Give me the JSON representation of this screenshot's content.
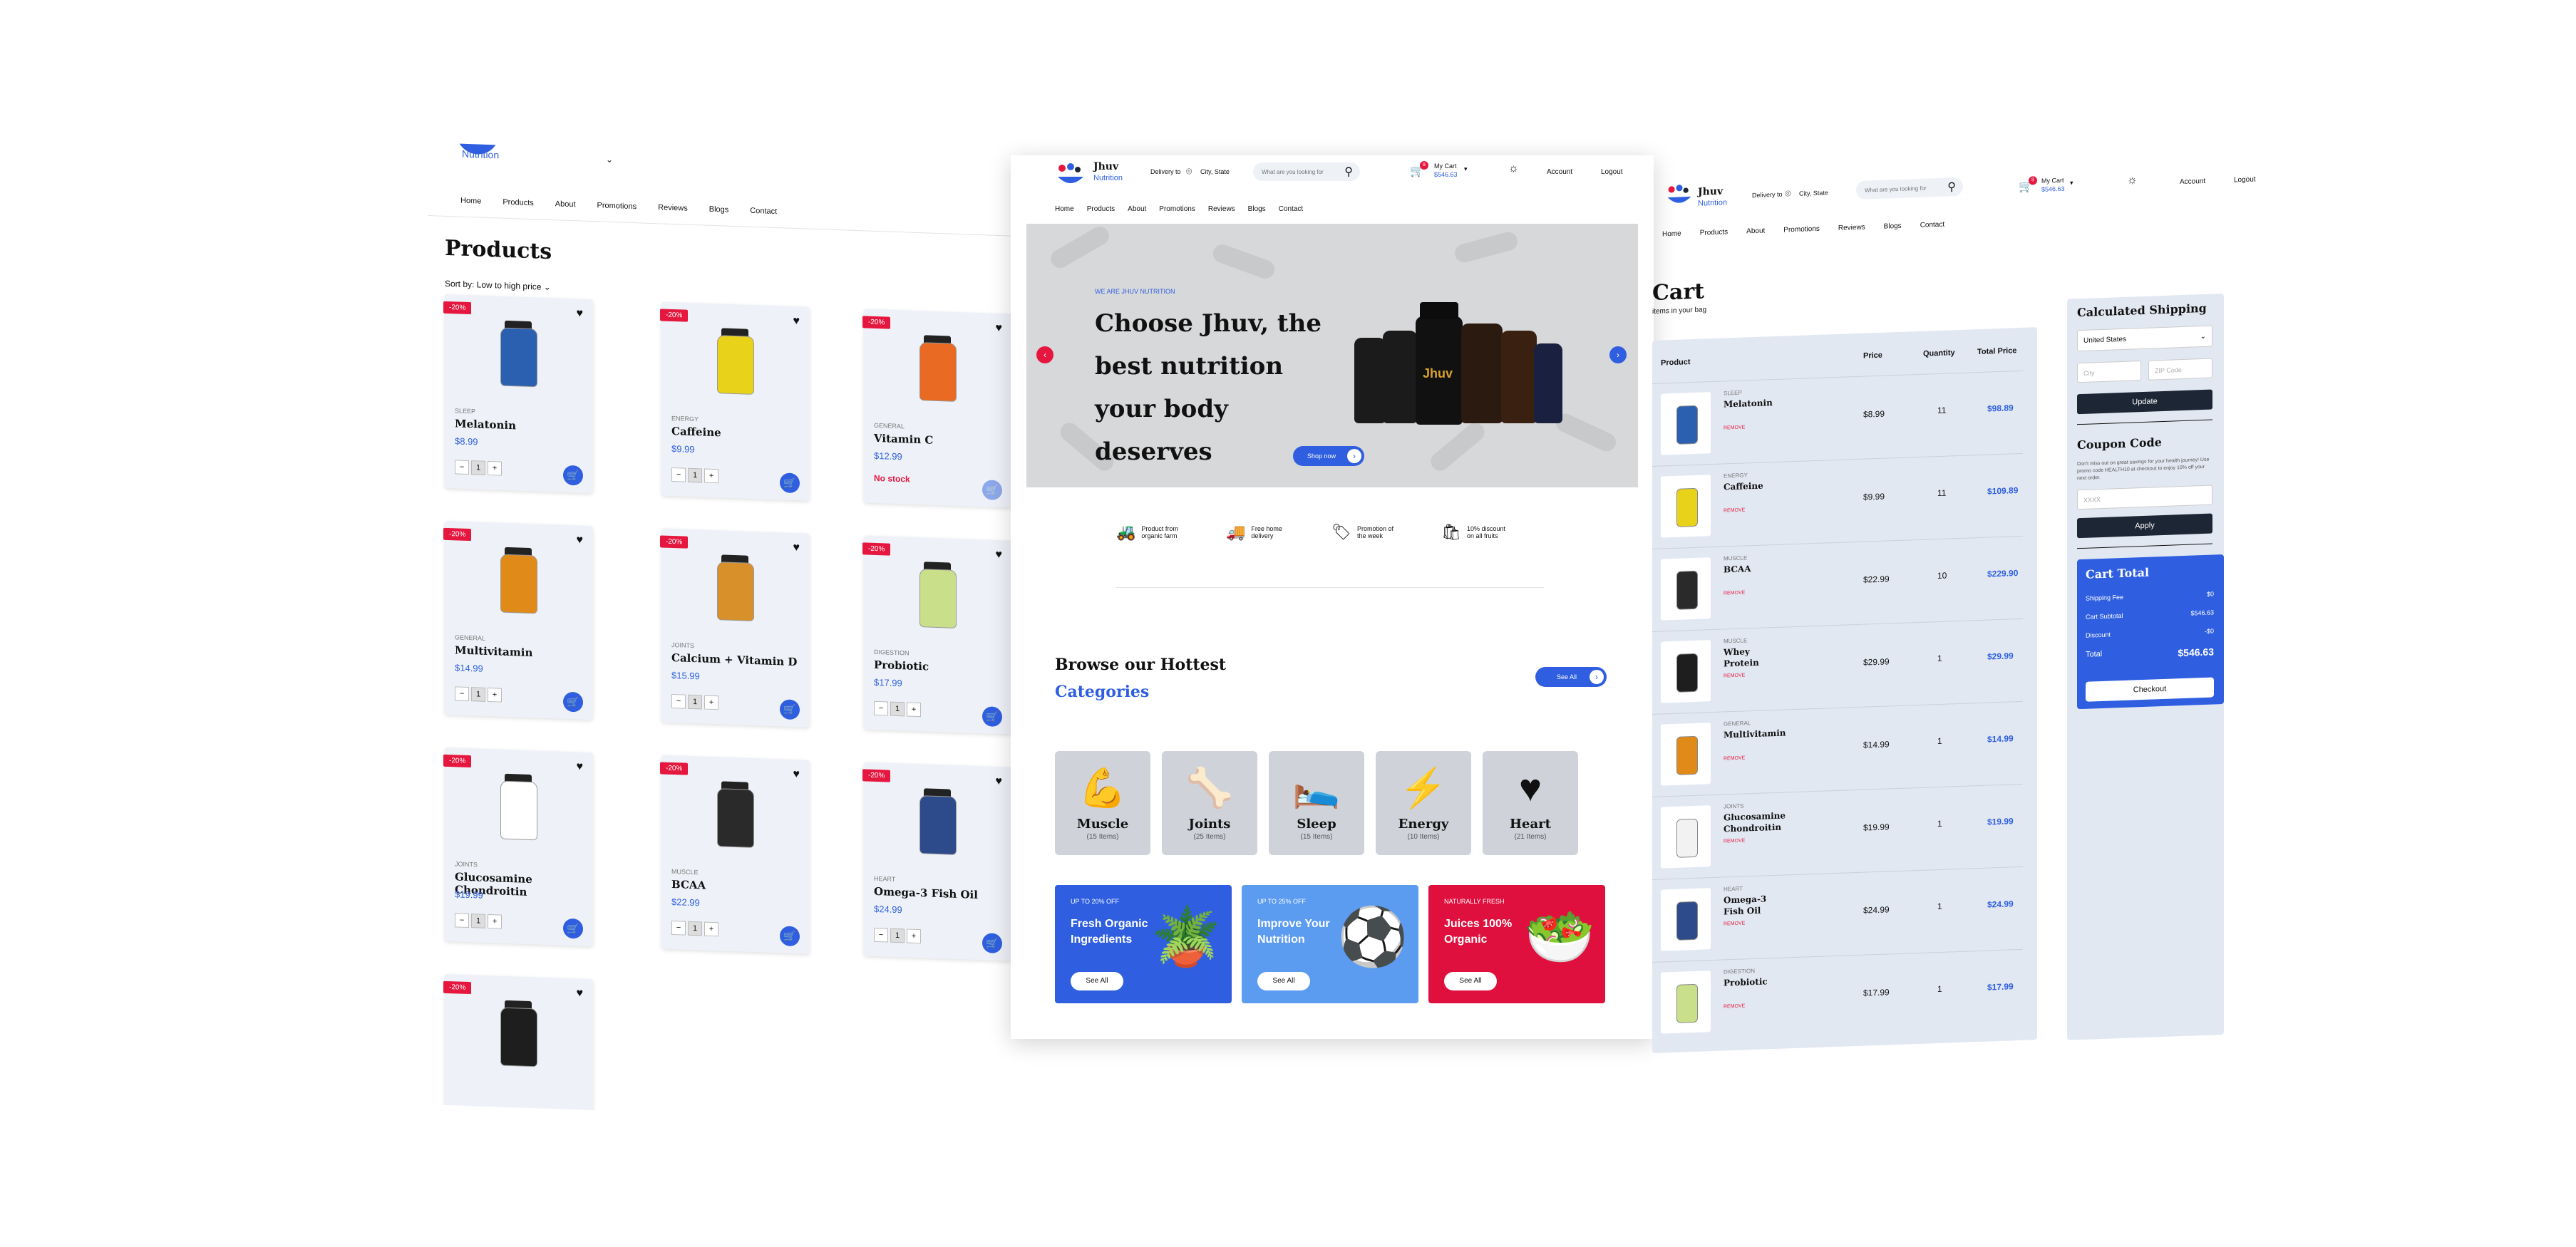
{
  "brand": {
    "name": "Jhuv",
    "sub": "Nutrition"
  },
  "header": {
    "delivery_label": "Delivery to",
    "city": "City, State",
    "search_placeholder": "What are you looking for",
    "cart_label": "My Cart",
    "cart_total": "$546.63",
    "cart_count": "8",
    "account": "Account",
    "logout": "Logout"
  },
  "nav": [
    "Home",
    "Products",
    "About",
    "Promotions",
    "Reviews",
    "Blogs",
    "Contact"
  ],
  "products_page": {
    "title": "Products",
    "sort": "Sort by: Low to high price",
    "products": [
      {
        "discount": "-20%",
        "category": "SLEEP",
        "name": "Melatonin",
        "price": "$8.99",
        "qty": "1",
        "color": "#2b5fb0"
      },
      {
        "discount": "-20%",
        "category": "ENERGY",
        "name": "Caffeine",
        "price": "$9.99",
        "qty": "1",
        "color": "#e9d21a"
      },
      {
        "discount": "-20%",
        "category": "GENERAL",
        "name": "Vitamin C",
        "price": "$12.99",
        "stock": "No stock",
        "color": "#e96a22"
      },
      {
        "discount": "-20%",
        "category": "GENERAL",
        "name": "Multivitamin",
        "price": "$14.99",
        "qty": "1",
        "color": "#e08a1a"
      },
      {
        "discount": "-20%",
        "category": "JOINTS",
        "name": "Calcium + Vitamin D",
        "price": "$15.99",
        "qty": "1",
        "color": "#d8902a"
      },
      {
        "discount": "-20%",
        "category": "DIGESTION",
        "name": "Probiotic",
        "price": "$17.99",
        "qty": "1",
        "color": "#c9df8a"
      },
      {
        "discount": "-20%",
        "category": "JOINTS",
        "name": "Glucosamine Chondroitin",
        "price": "$19.99",
        "qty": "1",
        "color": "#ffffff"
      },
      {
        "discount": "-20%",
        "category": "MUSCLE",
        "name": "BCAA",
        "price": "$22.99",
        "qty": "1",
        "color": "#2a2a2a"
      },
      {
        "discount": "-20%",
        "category": "HEART",
        "name": "Omega-3 Fish Oil",
        "price": "$24.99",
        "qty": "1",
        "color": "#2d4a8a"
      },
      {
        "discount": "-20%",
        "category": "",
        "name": "",
        "price": "",
        "qty": "",
        "color": "#1e1e1e"
      }
    ]
  },
  "home": {
    "hero": {
      "tag": "WE ARE JHUV NUTRITION",
      "title": "Choose Jhuv, the best nutrition your body deserves",
      "cta": "Shop now"
    },
    "features": [
      {
        "text": "Product from organic farm",
        "icon": "tractor-icon"
      },
      {
        "text": "Free home delivery",
        "icon": "truck-icon"
      },
      {
        "text": "Promotion of the week",
        "icon": "tag-icon"
      },
      {
        "text": "10% discount on all fruits",
        "icon": "discount-icon"
      }
    ],
    "browse_title_1": "Browse our Hottest",
    "browse_title_2": "Categories",
    "see_all": "See All",
    "categories": [
      {
        "name": "Muscle",
        "count": "(15 Items)",
        "icon": "muscle-icon"
      },
      {
        "name": "Joints",
        "count": "(25 Items)",
        "icon": "bone-icon"
      },
      {
        "name": "Sleep",
        "count": "(15 Items)",
        "icon": "sleep-icon"
      },
      {
        "name": "Energy",
        "count": "(10 Items)",
        "icon": "energy-icon"
      },
      {
        "name": "Heart",
        "count": "(21 Items)",
        "icon": "heart-icon"
      }
    ],
    "promos": [
      {
        "tag": "UP TO 20% OFF",
        "title": "Fresh Organic Ingredients",
        "button": "See All",
        "color": "#2f5fe0"
      },
      {
        "tag": "UP TO 25% OFF",
        "title": "Improve Your Nutrition",
        "button": "See All",
        "color": "#5b9bf0"
      },
      {
        "tag": "NATURALLY FRESH",
        "title": "Juices 100% Organic",
        "button": "See All",
        "color": "#e0103e"
      }
    ]
  },
  "cart_page": {
    "title": "Cart",
    "subtitle": "items in your bag",
    "columns": [
      "Product",
      "Price",
      "Quantity",
      "Total Price"
    ],
    "remove_label": "REMOVE",
    "items": [
      {
        "category": "SLEEP",
        "name": "Melatonin",
        "price": "$8.99",
        "qty": "11",
        "total": "$98.89",
        "color": "#2b5fb0"
      },
      {
        "category": "ENERGY",
        "name": "Caffeine",
        "price": "$9.99",
        "qty": "11",
        "total": "$109.89",
        "color": "#e9d21a"
      },
      {
        "category": "MUSCLE",
        "name": "BCAA",
        "price": "$22.99",
        "qty": "10",
        "total": "$229.90",
        "color": "#2a2a2a"
      },
      {
        "category": "MUSCLE",
        "name": "Whey Protein",
        "price": "$29.99",
        "qty": "1",
        "total": "$29.99",
        "color": "#1e1e1e"
      },
      {
        "category": "GENERAL",
        "name": "Multivitamin",
        "price": "$14.99",
        "qty": "1",
        "total": "$14.99",
        "color": "#e08a1a"
      },
      {
        "category": "JOINTS",
        "name": "Glucosamine Chondroitin",
        "price": "$19.99",
        "qty": "1",
        "total": "$19.99",
        "color": "#f2f2f2"
      },
      {
        "category": "HEART",
        "name": "Omega-3 Fish Oil",
        "price": "$24.99",
        "qty": "1",
        "total": "$24.99",
        "color": "#2d4a8a"
      },
      {
        "category": "DIGESTION",
        "name": "Probiotic",
        "price": "$17.99",
        "qty": "1",
        "total": "$17.99",
        "color": "#c9df8a"
      }
    ],
    "shipping": {
      "title": "Calculated Shipping",
      "country": "United States",
      "city_placeholder": "City",
      "zip_placeholder": "ZIP Code",
      "update": "Update"
    },
    "coupon": {
      "title": "Coupon Code",
      "desc": "Don't miss out on great savings for your health journey! Use promo code HEALTH10 at checkout to enjoy 10% off your next order.",
      "placeholder": "XXXX",
      "apply": "Apply"
    },
    "total": {
      "title": "Cart Total",
      "shipping_label": "Shipping Fee",
      "shipping_value": "$0",
      "subtotal_label": "Cart Subtotal",
      "subtotal_value": "$546.63",
      "discount_label": "Discount",
      "discount_value": "-$0",
      "total_label": "Total",
      "total_value": "$546.63",
      "checkout": "Checkout"
    }
  }
}
